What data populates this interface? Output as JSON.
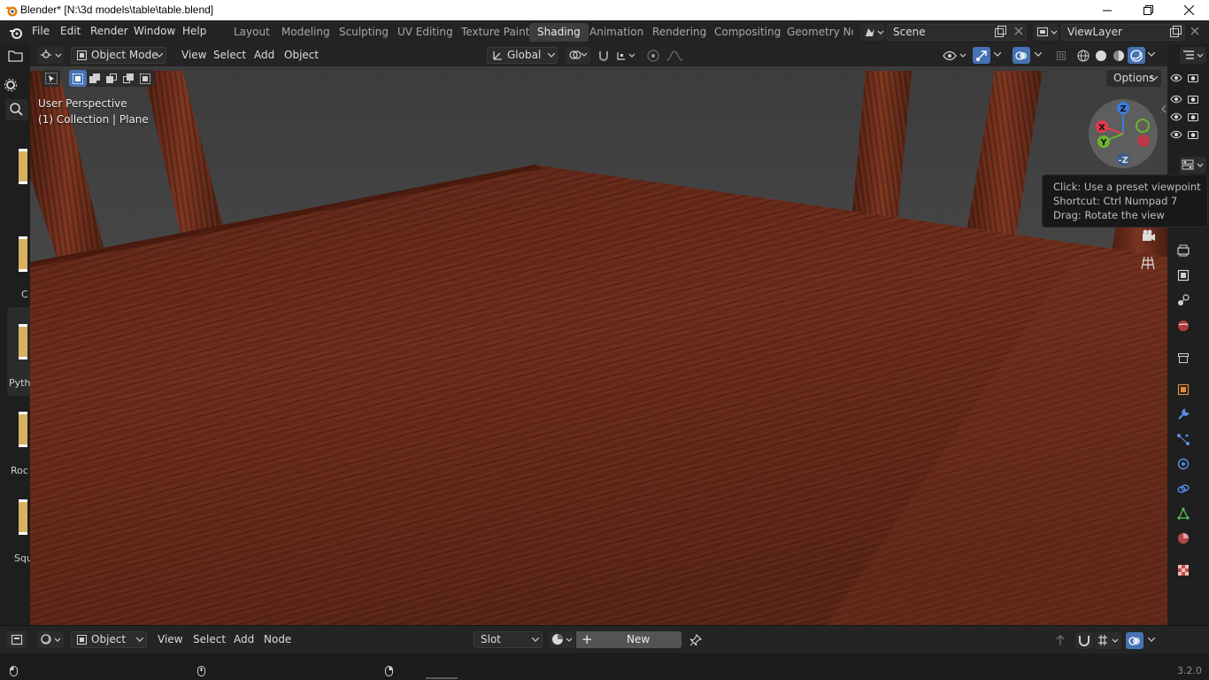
{
  "window": {
    "title": "Blender* [N:\\3d models\\table\\table.blend]",
    "minimize_icon": "minimize-icon",
    "maximize_icon": "restore-icon",
    "close_icon": "close-icon"
  },
  "topbar": {
    "menus": [
      "File",
      "Edit",
      "Render",
      "Window",
      "Help"
    ],
    "workspaces": [
      "Layout",
      "Modeling",
      "Sculpting",
      "UV Editing",
      "Texture Paint",
      "Shading",
      "Animation",
      "Rendering",
      "Compositing",
      "Geometry Noc"
    ],
    "active_workspace": "Shading",
    "scene_label": "Scene",
    "view_layer_label": "ViewLayer"
  },
  "viewport_header": {
    "mode": "Object Mode",
    "menus": [
      "View",
      "Select",
      "Add",
      "Object"
    ],
    "orientation": "Global",
    "options_label": "Options"
  },
  "viewport": {
    "perspective_label": "User Perspective",
    "collection_label": "(1) Collection | Plane",
    "gizmo": {
      "z": "Z",
      "x": "X",
      "y": "Y",
      "neg_z": "-Z"
    }
  },
  "tooltip": {
    "line1": "Click: Use a preset viewpoint",
    "line2": "Shortcut: Ctrl Numpad 7",
    "line3": "Drag: Rotate the view"
  },
  "file_browser_labels": [
    "C",
    "Pyth",
    "Roc",
    "Squ"
  ],
  "node_header": {
    "object_type": "Object",
    "menus": [
      "View",
      "Select",
      "Add",
      "Node"
    ],
    "slot": "Slot",
    "new_label": "New"
  },
  "statusbar": {
    "version": "3.2.0"
  },
  "colors": {
    "accent": "#4772b3",
    "active_tab": "#3d3d3d",
    "wood": "#6b2a1a",
    "gizmo_x": "#e53a4e",
    "gizmo_y": "#6eb52e",
    "gizmo_z": "#3b7de0"
  }
}
